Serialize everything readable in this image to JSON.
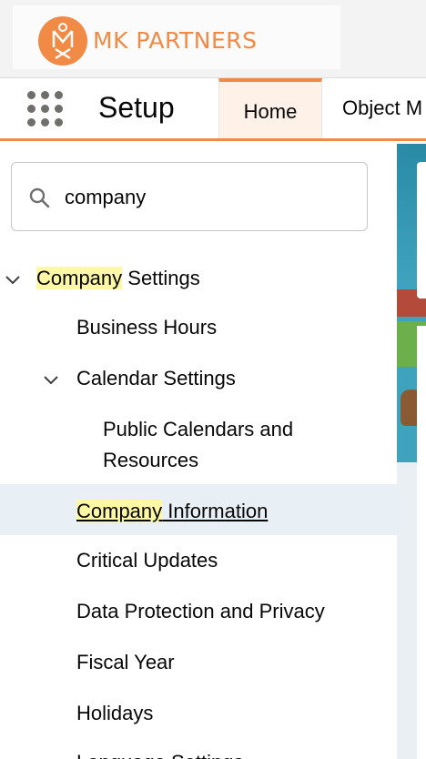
{
  "header": {
    "logo_text": "MK PARTNERS",
    "brand_color": "#f08a44"
  },
  "nav": {
    "app_title": "Setup",
    "tabs": [
      {
        "label": "Home",
        "active": true
      },
      {
        "label": "Object M"
      }
    ]
  },
  "search": {
    "value": "company",
    "icon": "search-icon"
  },
  "tree": {
    "company_settings": {
      "match": "Company",
      "rest": " Settings"
    },
    "business_hours": "Business Hours",
    "calendar_settings": "Calendar Settings",
    "public_calendars_line1": "Public Calendars and",
    "public_calendars_line2": "Resources",
    "company_information": {
      "match": "Company",
      "rest": " Information"
    },
    "critical_updates": "Critical Updates",
    "data_protection": "Data Protection and Privacy",
    "fiscal_year": "Fiscal Year",
    "holidays": "Holidays",
    "language_settings": "Language Settings"
  }
}
